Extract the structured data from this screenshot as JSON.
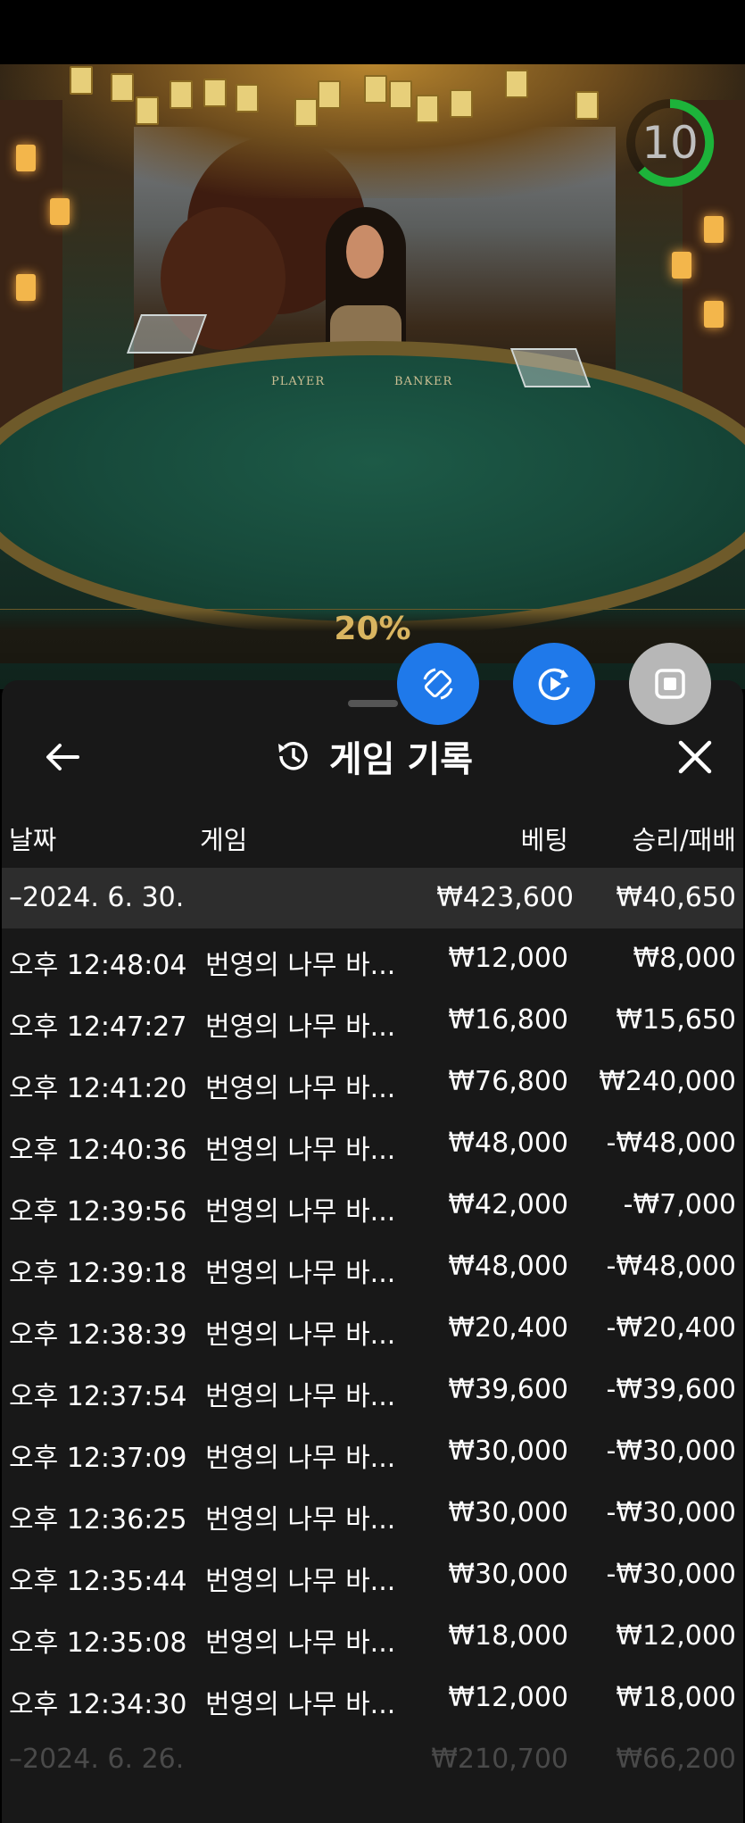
{
  "scene": {
    "table_labels": {
      "player": "PLAYER",
      "banker": "BANKER"
    },
    "timer": "10",
    "progress": "20%"
  },
  "actions": [
    {
      "name": "rotate-action-button",
      "icon": "rotate-phone-icon"
    },
    {
      "name": "replay-action-button",
      "icon": "replay-icon"
    },
    {
      "name": "stop-action-button",
      "icon": "stop-icon"
    }
  ],
  "panel": {
    "title": "게임 기록",
    "columns": {
      "date": "날짜",
      "game": "게임",
      "bet": "베팅",
      "win_loss": "승리/패배"
    },
    "date_group": {
      "date": "–2024. 6. 30.",
      "bet": "₩423,600",
      "win_loss": "₩40,650"
    },
    "rows": [
      {
        "time": "오후 12:48:04",
        "game": "번영의 나무 바...",
        "bet": "₩12,000",
        "win_loss": "₩8,000"
      },
      {
        "time": "오후 12:47:27",
        "game": "번영의 나무 바...",
        "bet": "₩16,800",
        "win_loss": "₩15,650"
      },
      {
        "time": "오후 12:41:20",
        "game": "번영의 나무 바...",
        "bet": "₩76,800",
        "win_loss": "₩240,000"
      },
      {
        "time": "오후 12:40:36",
        "game": "번영의 나무 바...",
        "bet": "₩48,000",
        "win_loss": "-₩48,000"
      },
      {
        "time": "오후 12:39:56",
        "game": "번영의 나무 바...",
        "bet": "₩42,000",
        "win_loss": "-₩7,000"
      },
      {
        "time": "오후 12:39:18",
        "game": "번영의 나무 바...",
        "bet": "₩48,000",
        "win_loss": "-₩48,000"
      },
      {
        "time": "오후 12:38:39",
        "game": "번영의 나무 바...",
        "bet": "₩20,400",
        "win_loss": "-₩20,400"
      },
      {
        "time": "오후 12:37:54",
        "game": "번영의 나무 바...",
        "bet": "₩39,600",
        "win_loss": "-₩39,600"
      },
      {
        "time": "오후 12:37:09",
        "game": "번영의 나무 바...",
        "bet": "₩30,000",
        "win_loss": "-₩30,000"
      },
      {
        "time": "오후 12:36:25",
        "game": "번영의 나무 바...",
        "bet": "₩30,000",
        "win_loss": "-₩30,000"
      },
      {
        "time": "오후 12:35:44",
        "game": "번영의 나무 바...",
        "bet": "₩30,000",
        "win_loss": "-₩30,000"
      },
      {
        "time": "오후 12:35:08",
        "game": "번영의 나무 바...",
        "bet": "₩18,000",
        "win_loss": "₩12,000"
      },
      {
        "time": "오후 12:34:30",
        "game": "번영의 나무 바...",
        "bet": "₩12,000",
        "win_loss": "₩18,000"
      }
    ],
    "next_date_group": {
      "date": "–2024. 6. 26.",
      "bet": "₩210,700",
      "win_loss": "₩66,200"
    }
  },
  "colors": {
    "accent_blue": "#1f79ea",
    "panel_bg": "#181818",
    "date_row_bg": "#2d2d2d",
    "timer_green": "#1db33a",
    "progress_gold": "#d9b560"
  }
}
